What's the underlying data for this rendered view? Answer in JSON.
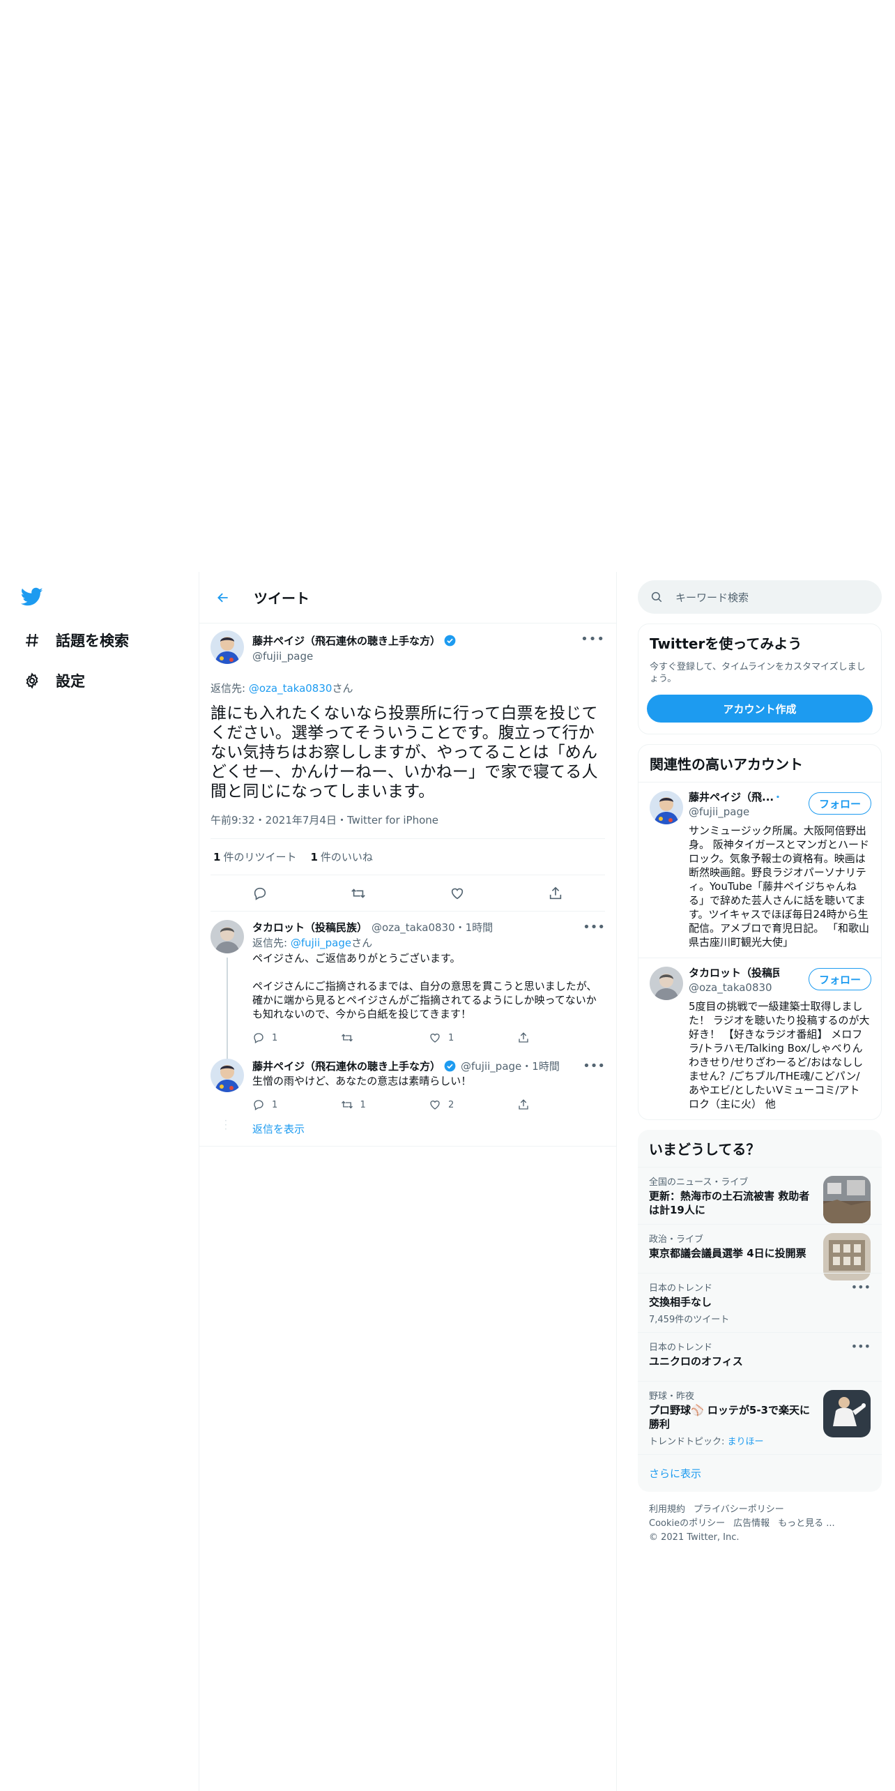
{
  "nav": {
    "explore_label": "話題を検索",
    "settings_label": "設定"
  },
  "header": {
    "title": "ツイート"
  },
  "main_tweet": {
    "display_name": "藤井ペイジ（飛石連休の聴き上手な方）",
    "handle": "@fujii_page",
    "reply_to_prefix": "返信先: ",
    "reply_to_handle": "@oza_taka0830",
    "reply_to_suffix": "さん",
    "body": "誰にも入れたくないなら投票所に行って白票を投じてください。選挙ってそういうことです。腹立って行かない気持ちはお察ししますが、やってることは「めんどくせー、かんけーねー、いかねー」で家で寝てる人間と同じになってしまいます。",
    "meta": "午前9:32・2021年7月4日・Twitter for iPhone",
    "retweets_count": "1",
    "retweets_label": "件のリツイート",
    "likes_count": "1",
    "likes_label": "件のいいね"
  },
  "replies": [
    {
      "display_name": "タカロット（投稿民族）",
      "sub": "@oza_taka0830・1時間",
      "reply_to_prefix": "返信先: ",
      "reply_to_handle": "@fujii_page",
      "reply_to_suffix": "さん",
      "body": "ペイジさん、ご返信ありがとうございます。\n\nペイジさんにご指摘されるまでは、自分の意思を貫こうと思いましたが、確かに端から見るとペイジさんがご指摘されてるようにしか映ってないかも知れないので、今から白紙を投じてきます！",
      "reply_count": "1",
      "retweet_count": "",
      "like_count": "1"
    },
    {
      "display_name": "藤井ペイジ（飛石連休の聴き上手な方）",
      "sub": "@fujii_page・1時間",
      "body": "生憎の雨やけど、あなたの意志は素晴らしい！",
      "reply_count": "1",
      "retweet_count": "1",
      "like_count": "2"
    }
  ],
  "show_replies_label": "返信を表示",
  "search": {
    "placeholder": "キーワード検索"
  },
  "signup": {
    "title": "Twitterを使ってみよう",
    "subtitle": "今すぐ登録して、タイムラインをカスタマイズしましょう。",
    "button": "アカウント作成"
  },
  "related": {
    "title": "関連性の高いアカウント",
    "follow_label": "フォロー",
    "accounts": [
      {
        "name": "藤井ペイジ（飛...",
        "handle": "@fujii_page",
        "bio": "サンミュージック所属。大阪阿倍野出身。 阪神タイガースとマンガとハードロック。気象予報士の資格有。映画は断然映画館。野良ラジオパーソナリティ。YouTube「藤井ペイジちゃんねる」で辞めた芸人さんに話を聴いてます。ツイキャスでほぼ毎日24時から生配信。アメブロで育児日記。 「和歌山県古座川町観光大使」"
      },
      {
        "name": "タカロット（投稿民...",
        "handle": "@oza_taka0830",
        "bio": "5度目の挑戦で一級建築士取得しました！ ラジオを聴いたり投稿するのが大好き！ 【好きなラジオ番組】 メロフラ/トラハモ/Talking Box/しゃべりんわきせり/せりざわーるど/おはなししません？/ごちブル/THE魂/こどパン/あやエビ/としたいVミューコミ/アトロク（主に火） 他"
      }
    ]
  },
  "trends": {
    "title": "いまどうしてる？",
    "items": [
      {
        "category": "全国のニュース・ライブ",
        "title": "更新：熱海市の土石流被害 救助者は計19人に",
        "count": ""
      },
      {
        "category": "政治・ライブ",
        "title": "東京都議会議員選挙 4日に投開票",
        "count": ""
      },
      {
        "category": "日本のトレンド",
        "title": "交換相手なし",
        "count": "7,459件のツイート"
      },
      {
        "category": "日本のトレンド",
        "title": "ユニクロのオフィス",
        "count": ""
      },
      {
        "category": "野球・昨夜",
        "title": "プロ野球⚾ ロッテが5-3で楽天に勝利",
        "count_prefix": "トレンドトピック: ",
        "count_link": "まりほー"
      }
    ],
    "show_more": "さらに表示"
  },
  "footer": {
    "terms": "利用規約",
    "privacy": "プライバシーポリシー",
    "cookie": "Cookieのポリシー",
    "ads": "広告情報",
    "more": "もっと見る ...",
    "copyright": "© 2021 Twitter, Inc."
  },
  "colors": {
    "accent": "#1d9bf0",
    "text": "#0f1419",
    "muted": "#536471",
    "border": "#eff3f4"
  }
}
